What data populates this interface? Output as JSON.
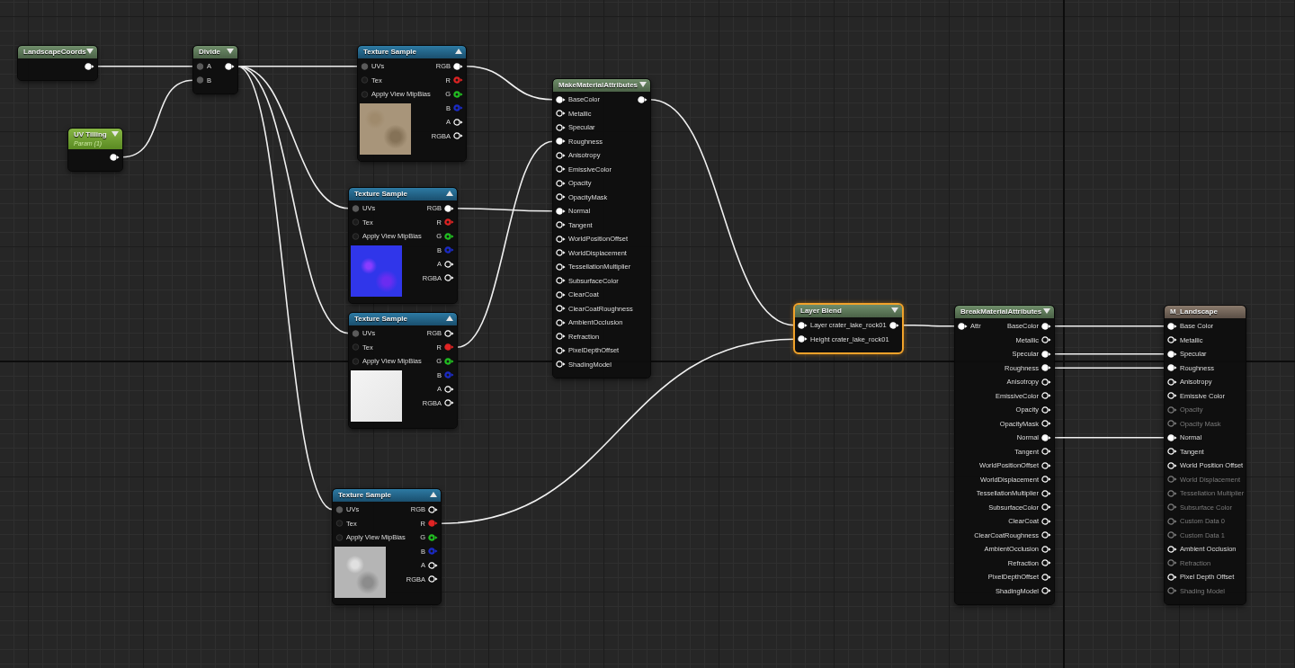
{
  "nodes": [
    {
      "title": "LandscapeCoords",
      "kind": "math",
      "selected": false,
      "expanded": false,
      "outputs": [
        {
          "kind": "attr",
          "connected": true
        }
      ]
    },
    {
      "title": "Divide",
      "kind": "math",
      "selected": false,
      "expanded": false,
      "inputs": [
        {
          "label": "A",
          "kind": "data",
          "connected": true
        },
        {
          "label": "B",
          "kind": "data",
          "connected": true
        }
      ],
      "outputs": [
        {
          "kind": "attr",
          "connected": true
        }
      ]
    },
    {
      "title": "UV Tilling",
      "subtitle": "Param (1)",
      "kind": "parameter",
      "selected": false,
      "expanded": false,
      "outputs": [
        {
          "kind": "attr",
          "connected": true
        }
      ]
    },
    {
      "title": "Texture Sample",
      "kind": "texture",
      "preview": {
        "kind": "sand"
      },
      "selected": false,
      "expanded": true,
      "inputs": [
        {
          "label": "UVs",
          "kind": "data",
          "connected": true
        },
        {
          "label": "Tex",
          "kind": "data",
          "connected": false
        },
        {
          "label": "Apply View MipBias",
          "kind": "data",
          "connected": false
        }
      ],
      "outputs": [
        {
          "label": "RGB",
          "kind": "attr",
          "connected": true
        },
        {
          "label": "R",
          "kind": "attr",
          "connected": false,
          "color": "#e02424"
        },
        {
          "label": "G",
          "kind": "attr",
          "connected": false,
          "color": "#22c022"
        },
        {
          "label": "B",
          "kind": "attr",
          "connected": false,
          "color": "#1c2cc8"
        },
        {
          "label": "A",
          "kind": "attr",
          "connected": false
        },
        {
          "label": "RGBA",
          "kind": "attr",
          "connected": false
        }
      ]
    },
    {
      "title": "Texture Sample",
      "kind": "texture",
      "preview": {
        "kind": "normal"
      },
      "selected": false,
      "expanded": true,
      "inputs": [
        {
          "label": "UVs",
          "kind": "data",
          "connected": true
        },
        {
          "label": "Tex",
          "kind": "data",
          "connected": false
        },
        {
          "label": "Apply View MipBias",
          "kind": "data",
          "connected": false
        }
      ],
      "outputs": [
        {
          "label": "RGB",
          "kind": "attr",
          "connected": true
        },
        {
          "label": "R",
          "kind": "attr",
          "connected": false,
          "color": "#e02424"
        },
        {
          "label": "G",
          "kind": "attr",
          "connected": false,
          "color": "#22c022"
        },
        {
          "label": "B",
          "kind": "attr",
          "connected": false,
          "color": "#1c2cc8"
        },
        {
          "label": "A",
          "kind": "attr",
          "connected": false
        },
        {
          "label": "RGBA",
          "kind": "attr",
          "connected": false
        }
      ]
    },
    {
      "title": "Texture Sample",
      "kind": "texture",
      "preview": {
        "kind": "white"
      },
      "selected": false,
      "expanded": true,
      "inputs": [
        {
          "label": "UVs",
          "kind": "data",
          "connected": true
        },
        {
          "label": "Tex",
          "kind": "data",
          "connected": false
        },
        {
          "label": "Apply View MipBias",
          "kind": "data",
          "connected": false
        }
      ],
      "outputs": [
        {
          "label": "RGB",
          "kind": "attr",
          "connected": false
        },
        {
          "label": "R",
          "kind": "attr",
          "connected": true,
          "color": "#e02424"
        },
        {
          "label": "G",
          "kind": "attr",
          "connected": false,
          "color": "#22c022"
        },
        {
          "label": "B",
          "kind": "attr",
          "connected": false,
          "color": "#1c2cc8"
        },
        {
          "label": "A",
          "kind": "attr",
          "connected": false
        },
        {
          "label": "RGBA",
          "kind": "attr",
          "connected": false
        }
      ]
    },
    {
      "title": "Texture Sample",
      "kind": "texture",
      "preview": {
        "kind": "grey"
      },
      "selected": false,
      "expanded": true,
      "inputs": [
        {
          "label": "UVs",
          "kind": "data",
          "connected": true
        },
        {
          "label": "Tex",
          "kind": "data",
          "connected": false
        },
        {
          "label": "Apply View MipBias",
          "kind": "data",
          "connected": false
        }
      ],
      "outputs": [
        {
          "label": "RGB",
          "kind": "attr",
          "connected": false
        },
        {
          "label": "R",
          "kind": "attr",
          "connected": true,
          "color": "#e02424"
        },
        {
          "label": "G",
          "kind": "attr",
          "connected": false,
          "color": "#22c022"
        },
        {
          "label": "B",
          "kind": "attr",
          "connected": false,
          "color": "#1c2cc8"
        },
        {
          "label": "A",
          "kind": "attr",
          "connected": false
        },
        {
          "label": "RGBA",
          "kind": "attr",
          "connected": false
        }
      ]
    },
    {
      "title": "MakeMaterialAttributes",
      "kind": "math",
      "selected": false,
      "expanded": false,
      "inputs": [
        {
          "label": "BaseColor",
          "kind": "attr",
          "connected": true
        },
        {
          "label": "Metallic",
          "kind": "attr",
          "connected": false
        },
        {
          "label": "Specular",
          "kind": "attr",
          "connected": false
        },
        {
          "label": "Roughness",
          "kind": "attr",
          "connected": true
        },
        {
          "label": "Anisotropy",
          "kind": "attr",
          "connected": false
        },
        {
          "label": "EmissiveColor",
          "kind": "attr",
          "connected": false
        },
        {
          "label": "Opacity",
          "kind": "attr",
          "connected": false
        },
        {
          "label": "OpacityMask",
          "kind": "attr",
          "connected": false
        },
        {
          "label": "Normal",
          "kind": "attr",
          "connected": true
        },
        {
          "label": "Tangent",
          "kind": "attr",
          "connected": false
        },
        {
          "label": "WorldPositionOffset",
          "kind": "attr",
          "connected": false
        },
        {
          "label": "WorldDisplacement",
          "kind": "attr",
          "connected": false
        },
        {
          "label": "TessellationMultiplier",
          "kind": "attr",
          "connected": false
        },
        {
          "label": "SubsurfaceColor",
          "kind": "attr",
          "connected": false
        },
        {
          "label": "ClearCoat",
          "kind": "attr",
          "connected": false
        },
        {
          "label": "ClearCoatRoughness",
          "kind": "attr",
          "connected": false
        },
        {
          "label": "AmbientOcclusion",
          "kind": "attr",
          "connected": false
        },
        {
          "label": "Refraction",
          "kind": "attr",
          "connected": false
        },
        {
          "label": "PixelDepthOffset",
          "kind": "attr",
          "connected": false
        },
        {
          "label": "ShadingModel",
          "kind": "attr",
          "connected": false
        }
      ],
      "outputs": [
        {
          "kind": "attr",
          "connected": true
        }
      ]
    },
    {
      "title": "Layer Blend",
      "kind": "math",
      "selected": true,
      "expanded": false,
      "inputs": [
        {
          "label": "Layer crater_lake_rock01",
          "kind": "attr",
          "connected": true
        },
        {
          "label": "Height crater_lake_rock01",
          "kind": "attr",
          "connected": true
        }
      ],
      "outputs": [
        {
          "kind": "attr",
          "connected": true
        }
      ]
    },
    {
      "title": "BreakMaterialAttributes",
      "kind": "math",
      "selected": false,
      "expanded": false,
      "inputs": [
        {
          "label": "Attr",
          "kind": "attr",
          "connected": true
        }
      ],
      "outputs": [
        {
          "label": "BaseColor",
          "kind": "attr",
          "connected": true
        },
        {
          "label": "Metallic",
          "kind": "attr",
          "connected": false
        },
        {
          "label": "Specular",
          "kind": "attr",
          "connected": true
        },
        {
          "label": "Roughness",
          "kind": "attr",
          "connected": true
        },
        {
          "label": "Anisotropy",
          "kind": "attr",
          "connected": false
        },
        {
          "label": "EmissiveColor",
          "kind": "attr",
          "connected": false
        },
        {
          "label": "Opacity",
          "kind": "attr",
          "connected": false
        },
        {
          "label": "OpacityMask",
          "kind": "attr",
          "connected": false
        },
        {
          "label": "Normal",
          "kind": "attr",
          "connected": true
        },
        {
          "label": "Tangent",
          "kind": "attr",
          "connected": false
        },
        {
          "label": "WorldPositionOffset",
          "kind": "attr",
          "connected": false
        },
        {
          "label": "WorldDisplacement",
          "kind": "attr",
          "connected": false
        },
        {
          "label": "TessellationMultiplier",
          "kind": "attr",
          "connected": false
        },
        {
          "label": "SubsurfaceColor",
          "kind": "attr",
          "connected": false
        },
        {
          "label": "ClearCoat",
          "kind": "attr",
          "connected": false
        },
        {
          "label": "ClearCoatRoughness",
          "kind": "attr",
          "connected": false
        },
        {
          "label": "AmbientOcclusion",
          "kind": "attr",
          "connected": false
        },
        {
          "label": "Refraction",
          "kind": "attr",
          "connected": false
        },
        {
          "label": "PixelDepthOffset",
          "kind": "attr",
          "connected": false
        },
        {
          "label": "ShadingModel",
          "kind": "attr",
          "connected": false
        }
      ]
    },
    {
      "title": "M_Landscape",
      "kind": "material",
      "selected": false,
      "inputs": [
        {
          "label": "Base Color",
          "kind": "attr",
          "connected": true,
          "disabled": false
        },
        {
          "label": "Metallic",
          "kind": "attr",
          "connected": false,
          "disabled": false
        },
        {
          "label": "Specular",
          "kind": "attr",
          "connected": true,
          "disabled": false
        },
        {
          "label": "Roughness",
          "kind": "attr",
          "connected": true,
          "disabled": false
        },
        {
          "label": "Anisotropy",
          "kind": "attr",
          "connected": false,
          "disabled": false
        },
        {
          "label": "Emissive Color",
          "kind": "attr",
          "connected": false,
          "disabled": false
        },
        {
          "label": "Opacity",
          "kind": "attr",
          "connected": false,
          "disabled": true
        },
        {
          "label": "Opacity Mask",
          "kind": "attr",
          "connected": false,
          "disabled": true
        },
        {
          "label": "Normal",
          "kind": "attr",
          "connected": true,
          "disabled": false
        },
        {
          "label": "Tangent",
          "kind": "attr",
          "connected": false,
          "disabled": false
        },
        {
          "label": "World Position Offset",
          "kind": "attr",
          "connected": false,
          "disabled": false
        },
        {
          "label": "World Displacement",
          "kind": "attr",
          "connected": false,
          "disabled": true
        },
        {
          "label": "Tessellation Multiplier",
          "kind": "attr",
          "connected": false,
          "disabled": true
        },
        {
          "label": "Subsurface Color",
          "kind": "attr",
          "connected": false,
          "disabled": true
        },
        {
          "label": "Custom Data 0",
          "kind": "attr",
          "connected": false,
          "disabled": true
        },
        {
          "label": "Custom Data 1",
          "kind": "attr",
          "connected": false,
          "disabled": true
        },
        {
          "label": "Ambient Occlusion",
          "kind": "attr",
          "connected": false,
          "disabled": false
        },
        {
          "label": "Refraction",
          "kind": "attr",
          "connected": false,
          "disabled": true
        },
        {
          "label": "Pixel Depth Offset",
          "kind": "attr",
          "connected": false,
          "disabled": false
        },
        {
          "label": "Shading Model",
          "kind": "attr",
          "connected": false,
          "disabled": true
        }
      ]
    }
  ]
}
